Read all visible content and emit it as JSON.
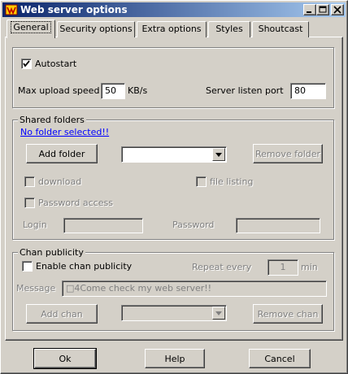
{
  "window": {
    "title": "Web server options",
    "caption_buttons": {
      "minimize": "_",
      "maximize": "□",
      "close": "×"
    }
  },
  "tabs": [
    {
      "label": "General",
      "active": true
    },
    {
      "label": "Security options",
      "active": false
    },
    {
      "label": "Extra options",
      "active": false
    },
    {
      "label": "Styles",
      "active": false
    },
    {
      "label": "Shoutcast",
      "active": false
    }
  ],
  "general": {
    "autostart_label": "Autostart",
    "autostart_checked": true,
    "max_upload_label": "Max upload speed",
    "max_upload_value": "50",
    "max_upload_unit": "KB/s",
    "listen_port_label": "Server listen port",
    "listen_port_value": "80"
  },
  "shared_folders": {
    "group_label": "Shared folders",
    "status_link": "No folder selected!!",
    "add_folder": "Add folder",
    "folder_select_value": "",
    "remove_folder": "Remove folder",
    "download_label": "download",
    "file_listing_label": "file listing",
    "password_access_label": "Password access",
    "login_label": "Login",
    "login_value": "",
    "password_label": "Password",
    "password_value": ""
  },
  "chan_publicity": {
    "group_label": "Chan publicity",
    "enable_label": "Enable chan publicity",
    "repeat_label": "Repeat every",
    "repeat_value": "1",
    "repeat_unit": "min",
    "message_label": "Message",
    "message_value": "□4Come check my web server!!",
    "add_chan": "Add chan",
    "chan_select_value": "",
    "remove_chan": "Remove chan"
  },
  "footer": {
    "ok": "Ok",
    "help": "Help",
    "cancel": "Cancel"
  },
  "colors": {
    "face": "#d4d0c8",
    "title_start": "#0a246a",
    "title_end": "#a6caf0",
    "link": "#0000ff"
  }
}
